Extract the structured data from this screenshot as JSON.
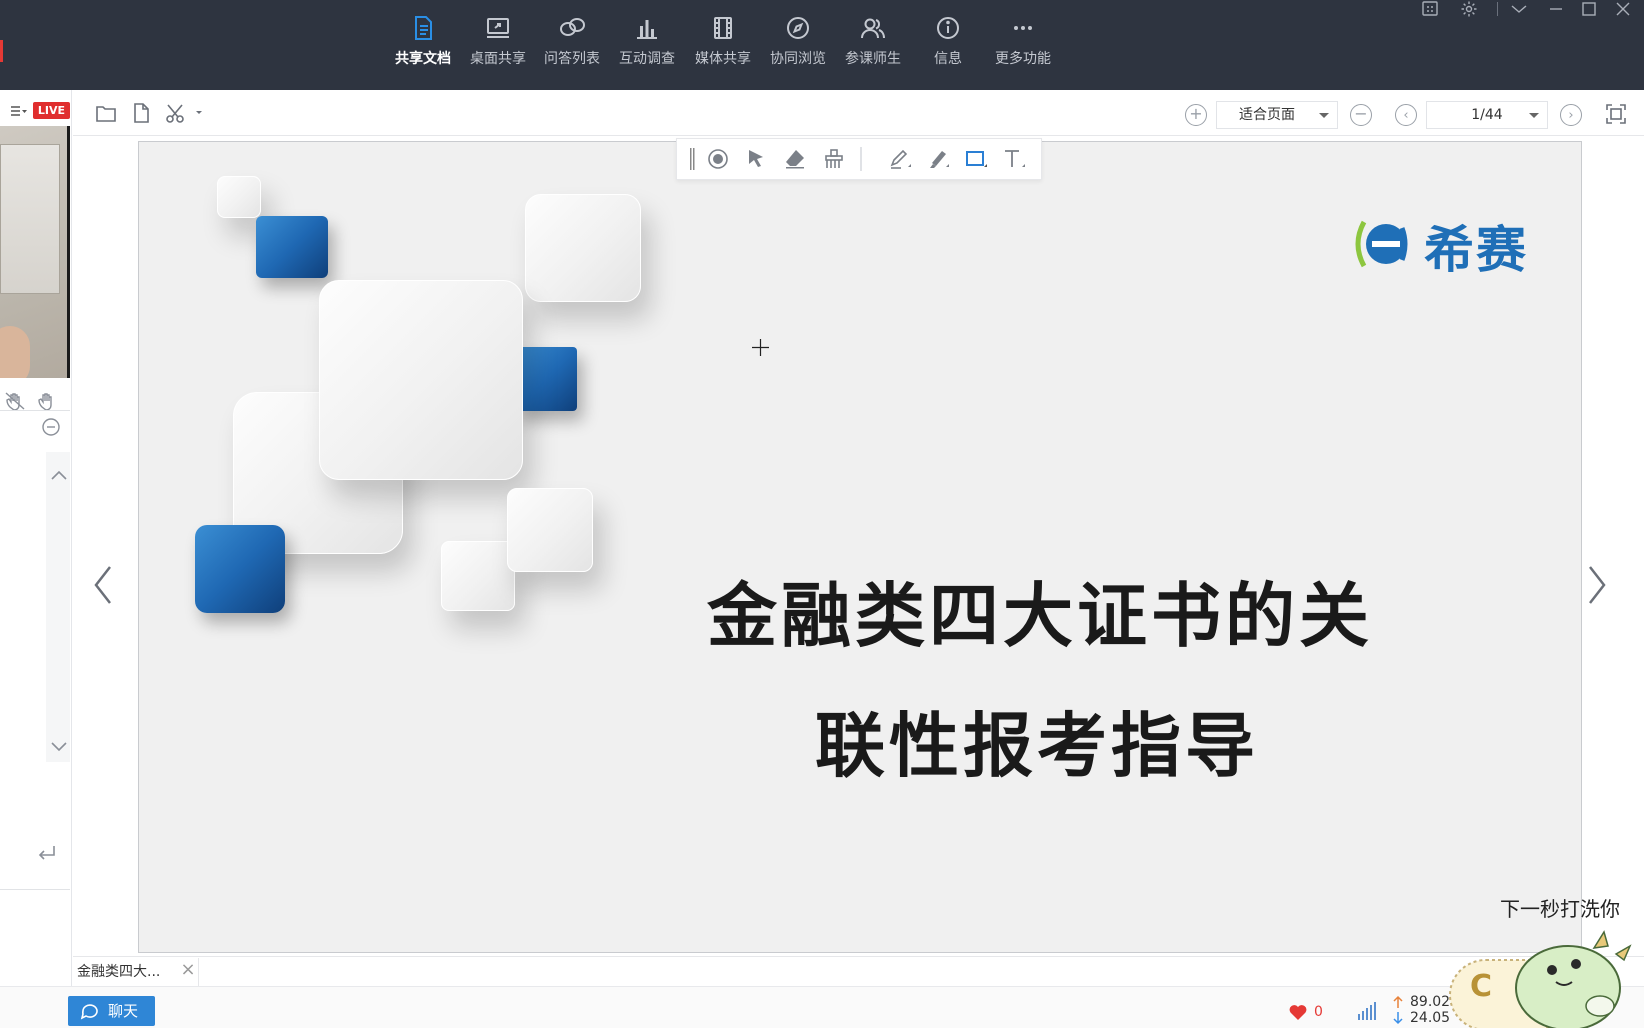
{
  "toolbar": {
    "items": [
      {
        "label": "共享文档",
        "icon": "document-icon",
        "active": true
      },
      {
        "label": "桌面共享",
        "icon": "desktop-share-icon",
        "active": false
      },
      {
        "label": "问答列表",
        "icon": "qa-list-icon",
        "active": false
      },
      {
        "label": "互动调查",
        "icon": "survey-chart-icon",
        "active": false
      },
      {
        "label": "媒体共享",
        "icon": "media-film-icon",
        "active": false
      },
      {
        "label": "协同浏览",
        "icon": "compass-icon",
        "active": false
      },
      {
        "label": "参课师生",
        "icon": "participants-icon",
        "active": false
      },
      {
        "label": "信息",
        "icon": "info-icon",
        "active": false
      },
      {
        "label": "更多功能",
        "icon": "more-dots-icon",
        "active": false
      }
    ]
  },
  "left_panel": {
    "live_badge": "LIVE"
  },
  "doc_toolbar": {
    "zoom_value": "适合页面",
    "page_value": "1/44"
  },
  "slide": {
    "brand": "希赛",
    "title_line1": "金融类四大证书的关",
    "title_line2": "联性报考指导",
    "colors": {
      "accent_blue": "#1f68b3",
      "background": "#f0f0f0"
    }
  },
  "tabs": {
    "doc_tab_label": "金融类四大..."
  },
  "status": {
    "chat_label": "聊天",
    "likes": "0",
    "upload": "89.02",
    "download": "24.05"
  },
  "mascot": {
    "caption": "下一秒打洗你"
  }
}
